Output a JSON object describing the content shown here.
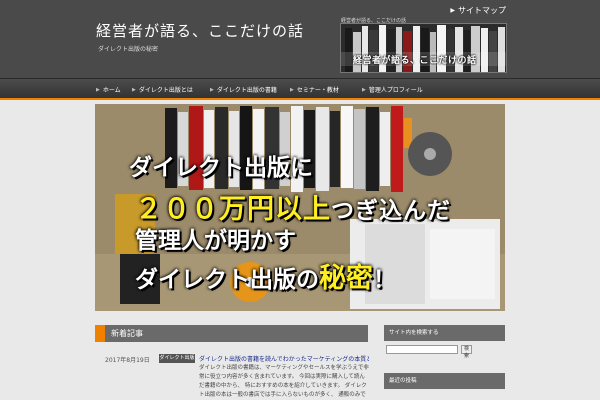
{
  "header": {
    "site_title": "経営者が語る、ここだけの話",
    "site_description": "ダイレクト出版の秘密",
    "sitemap_label": "サイトマップ",
    "banner_caption": "経営者が語る、ここだけの話",
    "banner_catch": "経営者が語る、ここだけの話"
  },
  "nav": {
    "items": [
      {
        "label": "ホーム"
      },
      {
        "label": "ダイレクト出版とは"
      },
      {
        "label": "ダイレクト出版の書籍"
      },
      {
        "label": "セミナー・教材"
      },
      {
        "label": "管理人プロフィール"
      }
    ]
  },
  "hero": {
    "line1": "ダイレクト出版に",
    "line2_highlight": "２００万円以上",
    "line2_rest": "つぎ込んだ",
    "line3": "管理人が明かす",
    "line4_start": "ダイレクト出版の",
    "line4_highlight": "秘密",
    "line4_end": "！"
  },
  "main": {
    "section_title": "新着記事",
    "posts": [
      {
        "date": "2017年8月19日",
        "category": "ダイレクト出版",
        "title": "ダイレクト出版の書籍を読んでわかったマーケティングの本質とは",
        "excerpt": "ダイレクト出版の書籍は、マーケティングやセールスを学ぶうえで非常に役立つ内容が多く含まれています。 今回は実際に購入して読んだ書籍の中から、 特におすすめの本を紹介していきます。 ダイレクト出版の本は一般の書店では手に入らないものが多く、 通販のみで販売されています。"
      }
    ]
  },
  "sidebar": {
    "search_title": "サイト内を検索する",
    "search_placeholder": "",
    "search_button": "検索",
    "recent_title": "最近の投稿"
  },
  "colors": {
    "accent": "#f08000",
    "header_bg": "#4a4a4a",
    "link": "#1a2a8a",
    "highlight_text": "#ffee22"
  }
}
